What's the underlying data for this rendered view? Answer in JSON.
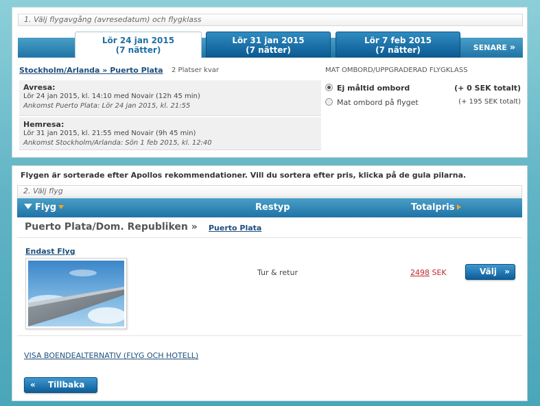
{
  "step1": {
    "label": "1. Välj flygavgång (avresedatum) och flygklass",
    "tabs": [
      {
        "date": "Lör 24 jan 2015",
        "nights": "(7 nätter)"
      },
      {
        "date": "Lör 31 jan 2015",
        "nights": "(7 nätter)"
      },
      {
        "date": "Lör 7 feb 2015",
        "nights": "(7 nätter)"
      }
    ],
    "later_label": "SENARE",
    "later_icon": "double-chevron-right",
    "route": "Stockholm/Arlanda » Puerto Plata",
    "seats_left": "2 Platser kvar",
    "outbound": {
      "title": "Avresa:",
      "line": "Lör 24 jan 2015, kl. 14:10 med Novair (12h 45 min)",
      "arrival": "Ankomst Puerto Plata: Lör 24 jan 2015, kl. 21:55"
    },
    "return": {
      "title": "Hemresa:",
      "line": "Lör 31 jan 2015, kl. 21:55 med Novair (9h 45 min)",
      "arrival": "Ankomst Stockholm/Arlanda: Sön 1 feb 2015, kl. 12:40"
    },
    "meal_heading": "MAT OMBORD/UPPGRADERAD FLYGKLASS",
    "meal_options": [
      {
        "label": "Ej måltid ombord",
        "price": "(+ 0 SEK totalt)",
        "selected": true
      },
      {
        "label": "Mat ombord på flyget",
        "price": "(+ 195 SEK totalt)",
        "selected": false
      }
    ]
  },
  "step2": {
    "sort_note": "Flygen är sorterade efter Apollos rekommendationer. Vill du sortera efter pris, klicka på de gula pilarna.",
    "label": "2. Välj flyg",
    "headers": {
      "flight": "Flyg",
      "trip_type": "Restyp",
      "total": "Totalpris"
    },
    "destination": "Puerto Plata/Dom. Republiken »",
    "destination_link": "Puerto Plata",
    "offer": {
      "title": "Endast Flyg",
      "trip_type": "Tur & retur",
      "price": "2498",
      "currency": "SEK",
      "select_label": "Välj"
    },
    "hotel_link": "VISA BOENDEALTERNATIV (FLYG OCH HOTELL)",
    "back_label": "Tillbaka"
  },
  "colors": {
    "accent_blue": "#1f73a6",
    "price_red": "#c0272d",
    "sort_arrow": "#f5a623"
  }
}
